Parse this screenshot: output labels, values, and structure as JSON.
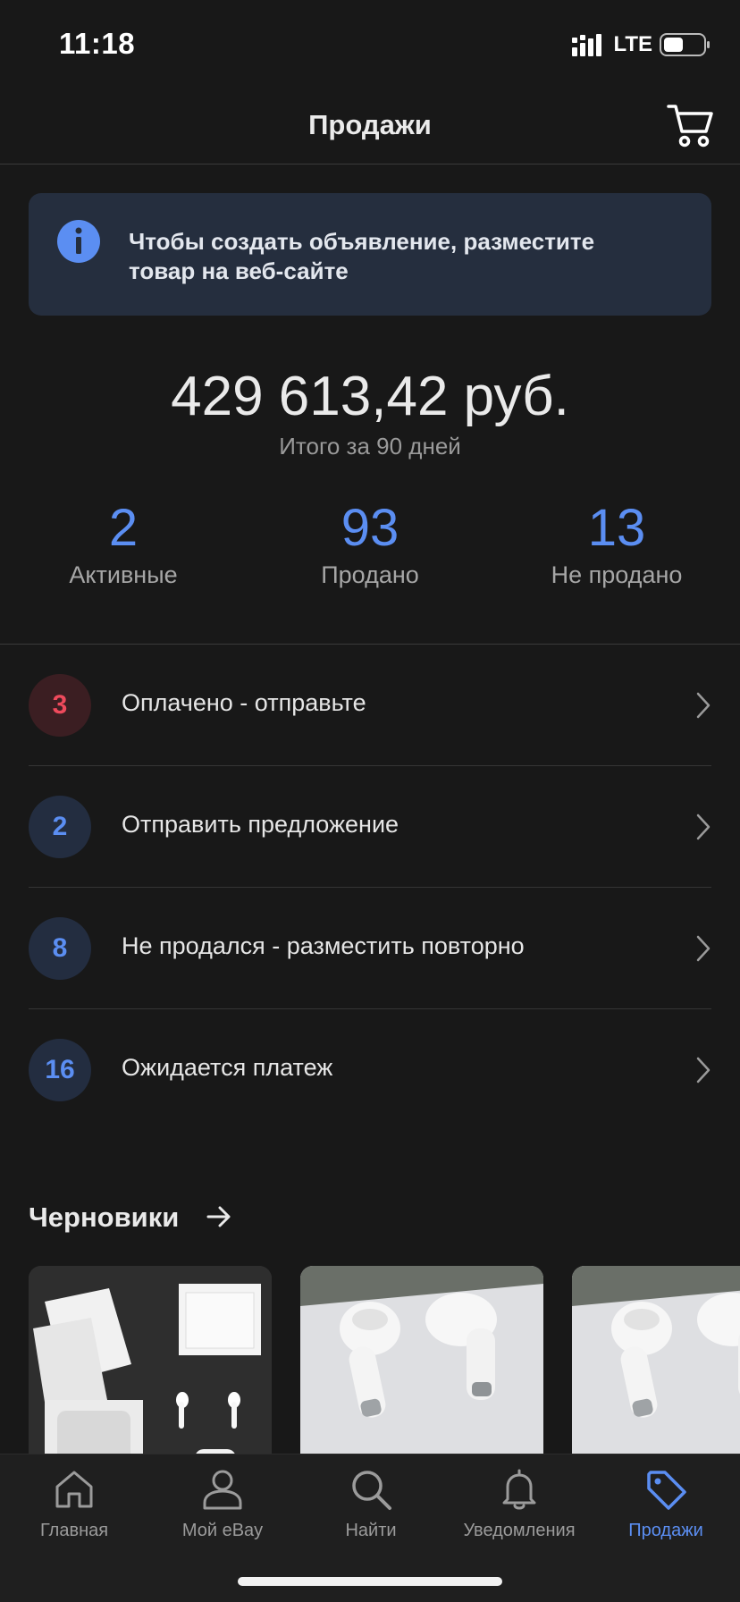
{
  "status_bar": {
    "time": "11:18",
    "network": "LTE",
    "battery_level": 0.5
  },
  "header": {
    "title": "Продажи",
    "cart_icon": "cart-icon"
  },
  "info_banner": {
    "icon": "info-icon",
    "text": "Чтобы создать объявление, разместите товар на веб-сайте"
  },
  "summary": {
    "amount": "429 613,42 руб.",
    "caption": "Итого за 90 дней"
  },
  "stats": [
    {
      "value": "2",
      "label": "Активные"
    },
    {
      "value": "93",
      "label": "Продано"
    },
    {
      "value": "13",
      "label": "Не продано"
    }
  ],
  "actions": [
    {
      "count": "3",
      "label": "Оплачено - отправьте",
      "badge_color": "#ee4a5c"
    },
    {
      "count": "2",
      "label": "Отправить предложение",
      "badge_color": "#5b8ef2"
    },
    {
      "count": "8",
      "label": "Не продался - разместить повторно",
      "badge_color": "#5b8ef2"
    },
    {
      "count": "16",
      "label": "Ожидается платеж",
      "badge_color": "#5b8ef2"
    }
  ],
  "drafts": {
    "title": "Черновики",
    "arrow_icon": "arrow-right-icon"
  },
  "tab_bar": {
    "items": [
      {
        "label": "Главная",
        "icon": "home-icon"
      },
      {
        "label": "Мой eBay",
        "icon": "person-icon"
      },
      {
        "label": "Найти",
        "icon": "search-icon"
      },
      {
        "label": "Уведомления",
        "icon": "bell-icon"
      },
      {
        "label": "Продажи",
        "icon": "tag-icon",
        "active": true
      }
    ]
  },
  "colors": {
    "accent": "#5b8ef2",
    "alert": "#ee4a5c",
    "background": "#181818"
  }
}
